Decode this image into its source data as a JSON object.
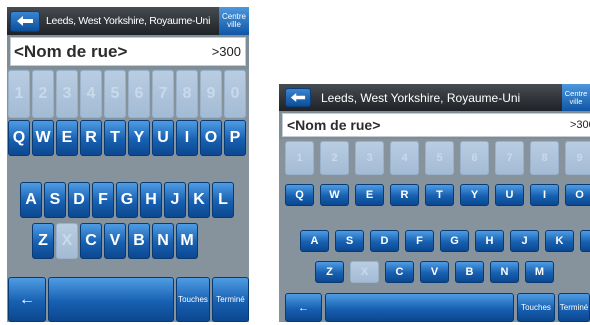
{
  "header": {
    "address": "Leeds, West Yorkshire, Royaume-Uni",
    "centre_button": "Centre ville"
  },
  "input": {
    "placeholder": "<Nom de rue>",
    "count": ">300"
  },
  "keyboard": {
    "number_row": [
      "1",
      "2",
      "3",
      "4",
      "5",
      "6",
      "7",
      "8",
      "9",
      "0"
    ],
    "row1": [
      "Q",
      "W",
      "E",
      "R",
      "T",
      "Y",
      "U",
      "I",
      "O",
      "P"
    ],
    "row2": [
      "A",
      "S",
      "D",
      "F",
      "G",
      "H",
      "J",
      "K",
      "L"
    ],
    "row3": [
      "Z",
      "X",
      "C",
      "V",
      "B",
      "N",
      "M"
    ],
    "disabled_letters": [
      "X"
    ],
    "bottom": {
      "backspace": "←",
      "space": "",
      "keys_button": "Touches",
      "done_button": "Terminé"
    }
  }
}
